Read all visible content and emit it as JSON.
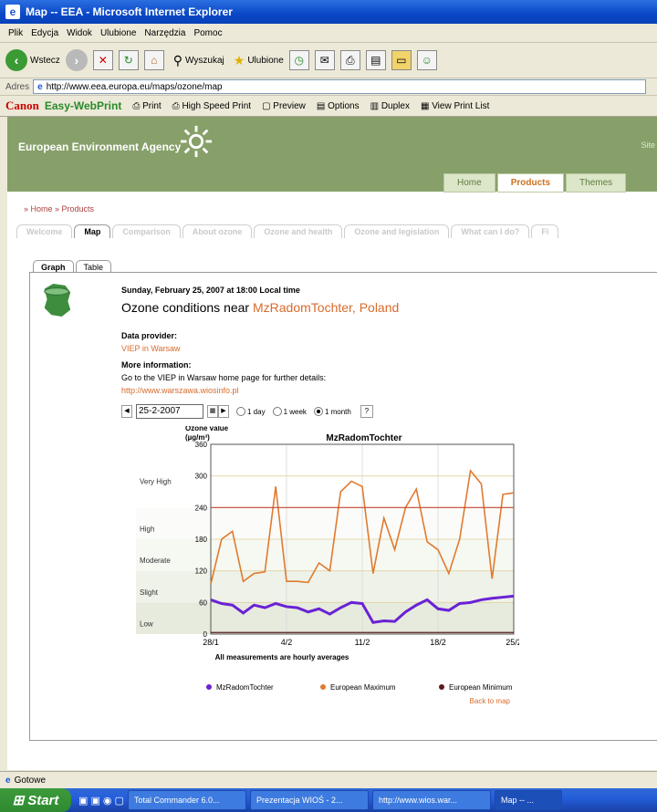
{
  "window": {
    "title": "Map -- EEA - Microsoft Internet Explorer"
  },
  "menu": [
    "Plik",
    "Edycja",
    "Widok",
    "Ulubione",
    "Narzędzia",
    "Pomoc"
  ],
  "toolbar": {
    "back": "Wstecz",
    "search": "Wyszukaj",
    "favorites": "Ulubione"
  },
  "address": {
    "label": "Adres",
    "url": "http://www.eea.europa.eu/maps/ozone/map"
  },
  "canon": {
    "brand": "Canon",
    "product": "Easy-WebPrint",
    "print": "Print",
    "hsprint": "High Speed Print",
    "preview": "Preview",
    "options": "Options",
    "duplex": "Duplex",
    "viewlist": "View Print List"
  },
  "site": {
    "name": "European Environment Agency",
    "site_label": "Site",
    "tabs": [
      "Home",
      "Products",
      "Themes"
    ]
  },
  "breadcrumb": "» Home » Products",
  "subtabs": [
    "Welcome",
    "Map",
    "Comparison",
    "About ozone",
    "Ozone and health",
    "Ozone and legislation",
    "What can I do?",
    "Fi"
  ],
  "graph_tabs": [
    "Graph",
    "Table"
  ],
  "info": {
    "datetime": "Sunday, February 25, 2007 at 18:00 Local time",
    "headline_prefix": "Ozone conditions near",
    "location": "MzRadomTochter, Poland",
    "provider_label": "Data provider:",
    "provider": "VIEP in Warsaw",
    "more_label": "More information:",
    "more_text": "Go to the  VIEP in Warsaw  home page for further details:",
    "more_link": "http://www.warszawa.wiosinfo.pl"
  },
  "controls": {
    "date": "25-2-2007",
    "opt1": "1 day",
    "opt2": "1 week",
    "opt3": "1 month",
    "help": "?"
  },
  "chart_data": {
    "type": "line",
    "title": "MzRadomTochter",
    "ylabel": "Ozone value\n(µg/m³)",
    "ylim": [
      0,
      360
    ],
    "yticks": [
      0,
      60,
      120,
      180,
      240,
      300,
      360
    ],
    "xticks": [
      "28/1",
      "4/2",
      "11/2",
      "18/2",
      "25/2"
    ],
    "xrange": [
      0,
      28
    ],
    "bands": [
      {
        "label": "Low",
        "from": 0,
        "to": 60
      },
      {
        "label": "Slight",
        "from": 60,
        "to": 120
      },
      {
        "label": "Moderate",
        "from": 120,
        "to": 180
      },
      {
        "label": "High",
        "from": 180,
        "to": 240
      },
      {
        "label": "Very High",
        "from": 240,
        "to": 360
      }
    ],
    "band_label_values": {
      "Low": 20,
      "Slight": 80,
      "Moderate": 140,
      "High": 200,
      "Very High": 290
    },
    "note": "All measurements are hourly averages",
    "series": [
      {
        "name": "MzRadomTochter",
        "color": "#6a22d4",
        "x": [
          0,
          1,
          2,
          3,
          4,
          5,
          6,
          7,
          8,
          9,
          10,
          11,
          12,
          13,
          14,
          15,
          16,
          17,
          18,
          19,
          20,
          21,
          22,
          23,
          24,
          25,
          26,
          27,
          28
        ],
        "values": [
          65,
          58,
          55,
          40,
          55,
          50,
          58,
          52,
          50,
          42,
          48,
          38,
          50,
          60,
          58,
          22,
          25,
          24,
          42,
          55,
          65,
          48,
          45,
          58,
          60,
          65,
          68,
          70,
          72
        ]
      },
      {
        "name": "European Maximum",
        "color": "#e07a30",
        "x": [
          0,
          1,
          2,
          3,
          4,
          5,
          6,
          7,
          8,
          9,
          10,
          11,
          12,
          13,
          14,
          15,
          16,
          17,
          18,
          19,
          20,
          21,
          22,
          23,
          24,
          25,
          26,
          27,
          28
        ],
        "values": [
          95,
          180,
          195,
          100,
          115,
          118,
          280,
          100,
          100,
          98,
          135,
          120,
          270,
          290,
          280,
          115,
          220,
          160,
          240,
          275,
          175,
          160,
          115,
          180,
          310,
          285,
          105,
          265,
          268
        ]
      },
      {
        "name": "European Maximum line",
        "color": "#c24a3a",
        "x": [
          0,
          28
        ],
        "values": [
          240,
          240
        ]
      },
      {
        "name": "European Minimum",
        "color": "#5a1a1a",
        "x": [
          0,
          28
        ],
        "values": [
          3,
          3
        ]
      }
    ]
  },
  "legend": [
    "MzRadomTochter",
    "European Maximum",
    "European Minimum"
  ],
  "back_link": "Back to map",
  "status": "Gotowe",
  "taskbar": {
    "start": "Start",
    "items": [
      "Total Commander 6.0...",
      "Prezentacja WIOŚ - 2...",
      "http://www.wios.war...",
      "Map -- ..."
    ]
  }
}
